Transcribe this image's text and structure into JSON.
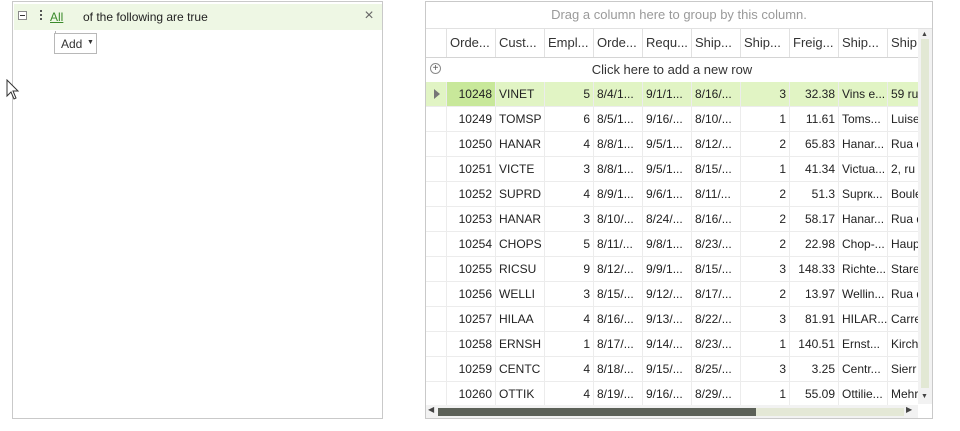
{
  "filter": {
    "operator": "All",
    "description": "of the following are true",
    "remove_glyph": "×",
    "add_label": "Add",
    "add_caret": "▼"
  },
  "grid": {
    "group_panel_text": "Drag a column here to group by this column.",
    "new_row_text": "Click here to add a new row",
    "columns": [
      "Orde...",
      "Cust...",
      "Empl...",
      "Orde...",
      "Requ...",
      "Ship...",
      "Ship...",
      "Freig...",
      "Ship...",
      "Ship"
    ],
    "rows": [
      [
        "10248",
        "VINET",
        "5",
        "8/4/1...",
        "9/1/1...",
        "8/16/...",
        "3",
        "32.38",
        "Vins e...",
        "59 ru"
      ],
      [
        "10249",
        "TOMSP",
        "6",
        "8/5/1...",
        "9/16/...",
        "8/10/...",
        "1",
        "11.61",
        "Toms...",
        "Luise"
      ],
      [
        "10250",
        "HANAR",
        "4",
        "8/8/1...",
        "9/5/1...",
        "8/12/...",
        "2",
        "65.83",
        "Hanar...",
        "Rua d"
      ],
      [
        "10251",
        "VICTE",
        "3",
        "8/8/1...",
        "9/5/1...",
        "8/15/...",
        "1",
        "41.34",
        "Victua...",
        "2, ru"
      ],
      [
        "10252",
        "SUPRD",
        "4",
        "8/9/1...",
        "9/6/1...",
        "8/11/...",
        "2",
        "51.3",
        "Suprк...",
        "Boule"
      ],
      [
        "10253",
        "HANAR",
        "3",
        "8/10/...",
        "8/24/...",
        "8/16/...",
        "2",
        "58.17",
        "Hanar...",
        "Rua d"
      ],
      [
        "10254",
        "CHOPS",
        "5",
        "8/11/...",
        "9/8/1...",
        "8/23/...",
        "2",
        "22.98",
        "Chop-...",
        "Haup"
      ],
      [
        "10255",
        "RICSU",
        "9",
        "8/12/...",
        "9/9/1...",
        "8/15/...",
        "3",
        "148.33",
        "Richte...",
        "Stare"
      ],
      [
        "10256",
        "WELLI",
        "3",
        "8/15/...",
        "9/12/...",
        "8/17/...",
        "2",
        "13.97",
        "Wellin...",
        "Rua d"
      ],
      [
        "10257",
        "HILAA",
        "4",
        "8/16/...",
        "9/13/...",
        "8/22/...",
        "3",
        "81.91",
        "HILAR...",
        "Carre"
      ],
      [
        "10258",
        "ERNSH",
        "1",
        "8/17/...",
        "9/14/...",
        "8/23/...",
        "1",
        "140.51",
        "Ernst...",
        "Kirch"
      ],
      [
        "10259",
        "CENTC",
        "4",
        "8/18/...",
        "9/15/...",
        "8/25/...",
        "3",
        "3.25",
        "Centr...",
        "Sierr"
      ],
      [
        "10260",
        "OTTIK",
        "4",
        "8/19/...",
        "9/16/...",
        "8/29/...",
        "1",
        "55.09",
        "Ottilie...",
        "Mehr"
      ]
    ],
    "selected_row": 0,
    "accent_color": "#e1f4c4"
  }
}
